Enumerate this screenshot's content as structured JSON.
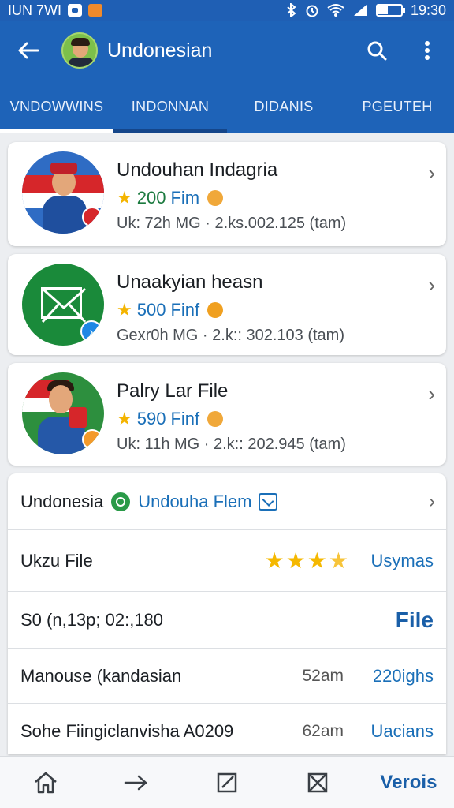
{
  "status": {
    "carrier": "IUN 7WI",
    "time": "19:30"
  },
  "app_bar": {
    "title": "Undonesian"
  },
  "tabs": [
    {
      "label": "VNDOWWINS"
    },
    {
      "label": "INDONNAN"
    },
    {
      "label": "DIDANIS"
    },
    {
      "label": "PGEUTEH"
    }
  ],
  "cards": [
    {
      "title": "Undouhan Indagria",
      "rating_num": "200",
      "rating_unit": "Fim",
      "meta": "Uk: 72h MG · 2.ks.002.125 (tam)"
    },
    {
      "title": "Unaakyian heasn",
      "rating_num": "500",
      "rating_unit": "Finf",
      "meta": "Gexr0h MG · 2.k:: 302.103 (tam)"
    },
    {
      "title": "Palry Lar File",
      "rating_num": "590",
      "rating_unit": "Finf",
      "meta": "Uk: 11h MG · 2.k:: 202.945 (tam)"
    }
  ],
  "list": {
    "header_label": "Undonesia",
    "header_link": "Undouha Flem",
    "row1_label": "Ukzu File",
    "row1_value": "Usymas",
    "row2_label": "S0 (n,13p; 02:,180",
    "row2_value": "File",
    "row3_label": "Manouse (kandasian",
    "row3_time": "52am",
    "row3_value": "220ighs",
    "row4_label": "Sohe Fiingiclanvisha A0209",
    "row4_time": "62am",
    "row4_value": "Uacians"
  },
  "bottom_nav": {
    "label": "Verois"
  },
  "colors": {
    "primary": "#1e63b8",
    "accent_green": "#1b7a3f",
    "star": "#f4b400"
  }
}
